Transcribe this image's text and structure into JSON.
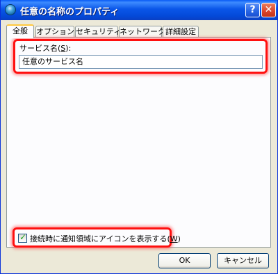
{
  "window": {
    "title": "任意の名称のプロパティ",
    "help_glyph": "?",
    "close_glyph": "✕"
  },
  "tabs": [
    {
      "label": "全般",
      "active": true
    },
    {
      "label": "オプション",
      "active": false
    },
    {
      "label": "セキュリティ",
      "active": false
    },
    {
      "label": "ネットワーク",
      "active": false
    },
    {
      "label": "詳細設定",
      "active": false
    }
  ],
  "general": {
    "service_name_label": "サービス名(",
    "service_name_accel": "S",
    "service_name_label_end": "):",
    "service_name_value": "任意のサービス名",
    "tray_icon_checkbox": {
      "checked": true,
      "label": "接続時に通知領域にアイコンを表示する(",
      "accel": "W",
      "label_end": ")"
    }
  },
  "buttons": {
    "ok": "OK",
    "cancel": "キャンセル"
  },
  "colors": {
    "titlebar": "#0a56e8",
    "highlight": "#ff1010",
    "dialog_bg": "#ece9d8",
    "tab_accent": "#ffc83c"
  }
}
